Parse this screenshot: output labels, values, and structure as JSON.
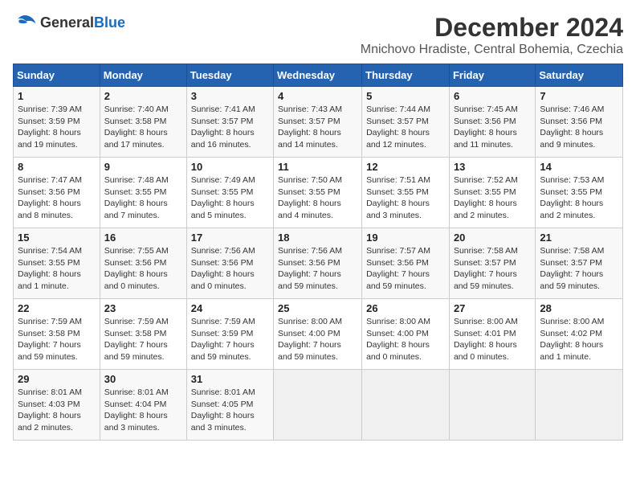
{
  "logo": {
    "general": "General",
    "blue": "Blue"
  },
  "header": {
    "title": "December 2024",
    "subtitle": "Mnichovo Hradiste, Central Bohemia, Czechia"
  },
  "weekdays": [
    "Sunday",
    "Monday",
    "Tuesday",
    "Wednesday",
    "Thursday",
    "Friday",
    "Saturday"
  ],
  "weeks": [
    [
      {
        "day": "1",
        "info": "Sunrise: 7:39 AM\nSunset: 3:59 PM\nDaylight: 8 hours\nand 19 minutes."
      },
      {
        "day": "2",
        "info": "Sunrise: 7:40 AM\nSunset: 3:58 PM\nDaylight: 8 hours\nand 17 minutes."
      },
      {
        "day": "3",
        "info": "Sunrise: 7:41 AM\nSunset: 3:57 PM\nDaylight: 8 hours\nand 16 minutes."
      },
      {
        "day": "4",
        "info": "Sunrise: 7:43 AM\nSunset: 3:57 PM\nDaylight: 8 hours\nand 14 minutes."
      },
      {
        "day": "5",
        "info": "Sunrise: 7:44 AM\nSunset: 3:57 PM\nDaylight: 8 hours\nand 12 minutes."
      },
      {
        "day": "6",
        "info": "Sunrise: 7:45 AM\nSunset: 3:56 PM\nDaylight: 8 hours\nand 11 minutes."
      },
      {
        "day": "7",
        "info": "Sunrise: 7:46 AM\nSunset: 3:56 PM\nDaylight: 8 hours\nand 9 minutes."
      }
    ],
    [
      {
        "day": "8",
        "info": "Sunrise: 7:47 AM\nSunset: 3:56 PM\nDaylight: 8 hours\nand 8 minutes."
      },
      {
        "day": "9",
        "info": "Sunrise: 7:48 AM\nSunset: 3:55 PM\nDaylight: 8 hours\nand 7 minutes."
      },
      {
        "day": "10",
        "info": "Sunrise: 7:49 AM\nSunset: 3:55 PM\nDaylight: 8 hours\nand 5 minutes."
      },
      {
        "day": "11",
        "info": "Sunrise: 7:50 AM\nSunset: 3:55 PM\nDaylight: 8 hours\nand 4 minutes."
      },
      {
        "day": "12",
        "info": "Sunrise: 7:51 AM\nSunset: 3:55 PM\nDaylight: 8 hours\nand 3 minutes."
      },
      {
        "day": "13",
        "info": "Sunrise: 7:52 AM\nSunset: 3:55 PM\nDaylight: 8 hours\nand 2 minutes."
      },
      {
        "day": "14",
        "info": "Sunrise: 7:53 AM\nSunset: 3:55 PM\nDaylight: 8 hours\nand 2 minutes."
      }
    ],
    [
      {
        "day": "15",
        "info": "Sunrise: 7:54 AM\nSunset: 3:55 PM\nDaylight: 8 hours\nand 1 minute."
      },
      {
        "day": "16",
        "info": "Sunrise: 7:55 AM\nSunset: 3:56 PM\nDaylight: 8 hours\nand 0 minutes."
      },
      {
        "day": "17",
        "info": "Sunrise: 7:56 AM\nSunset: 3:56 PM\nDaylight: 8 hours\nand 0 minutes."
      },
      {
        "day": "18",
        "info": "Sunrise: 7:56 AM\nSunset: 3:56 PM\nDaylight: 7 hours\nand 59 minutes."
      },
      {
        "day": "19",
        "info": "Sunrise: 7:57 AM\nSunset: 3:56 PM\nDaylight: 7 hours\nand 59 minutes."
      },
      {
        "day": "20",
        "info": "Sunrise: 7:58 AM\nSunset: 3:57 PM\nDaylight: 7 hours\nand 59 minutes."
      },
      {
        "day": "21",
        "info": "Sunrise: 7:58 AM\nSunset: 3:57 PM\nDaylight: 7 hours\nand 59 minutes."
      }
    ],
    [
      {
        "day": "22",
        "info": "Sunrise: 7:59 AM\nSunset: 3:58 PM\nDaylight: 7 hours\nand 59 minutes."
      },
      {
        "day": "23",
        "info": "Sunrise: 7:59 AM\nSunset: 3:58 PM\nDaylight: 7 hours\nand 59 minutes."
      },
      {
        "day": "24",
        "info": "Sunrise: 7:59 AM\nSunset: 3:59 PM\nDaylight: 7 hours\nand 59 minutes."
      },
      {
        "day": "25",
        "info": "Sunrise: 8:00 AM\nSunset: 4:00 PM\nDaylight: 7 hours\nand 59 minutes."
      },
      {
        "day": "26",
        "info": "Sunrise: 8:00 AM\nSunset: 4:00 PM\nDaylight: 8 hours\nand 0 minutes."
      },
      {
        "day": "27",
        "info": "Sunrise: 8:00 AM\nSunset: 4:01 PM\nDaylight: 8 hours\nand 0 minutes."
      },
      {
        "day": "28",
        "info": "Sunrise: 8:00 AM\nSunset: 4:02 PM\nDaylight: 8 hours\nand 1 minute."
      }
    ],
    [
      {
        "day": "29",
        "info": "Sunrise: 8:01 AM\nSunset: 4:03 PM\nDaylight: 8 hours\nand 2 minutes."
      },
      {
        "day": "30",
        "info": "Sunrise: 8:01 AM\nSunset: 4:04 PM\nDaylight: 8 hours\nand 3 minutes."
      },
      {
        "day": "31",
        "info": "Sunrise: 8:01 AM\nSunset: 4:05 PM\nDaylight: 8 hours\nand 3 minutes."
      },
      {
        "day": "",
        "info": ""
      },
      {
        "day": "",
        "info": ""
      },
      {
        "day": "",
        "info": ""
      },
      {
        "day": "",
        "info": ""
      }
    ]
  ]
}
